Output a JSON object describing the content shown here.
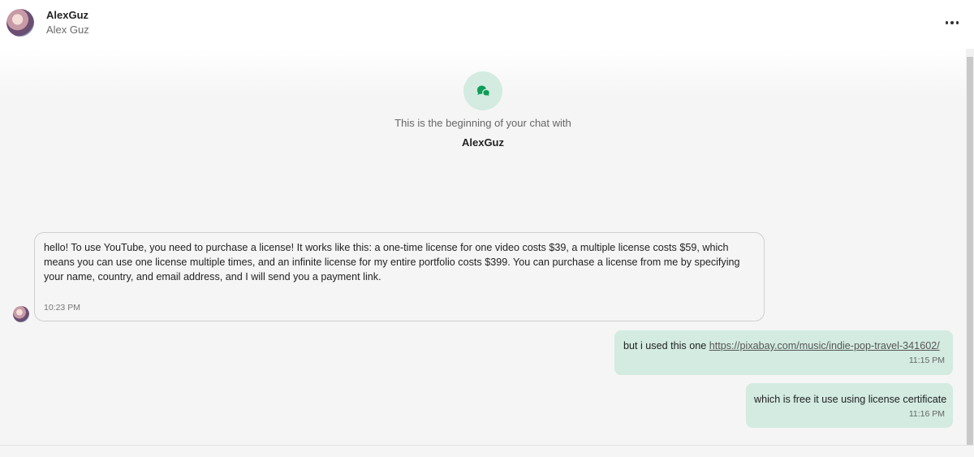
{
  "header": {
    "display_name": "AlexGuz",
    "username": "Alex Guz",
    "more_icon": "more-horizontal-icon"
  },
  "chat_start": {
    "icon": "chat-bubbles-icon",
    "text": "This is the beginning of your chat with",
    "name": "AlexGuz"
  },
  "messages": [
    {
      "direction": "incoming",
      "text": "hello! To use YouTube, you need to purchase a license! It works like this: a one-time license for one video costs $39, a multiple license costs $59, which means you can use one license multiple times, and an infinite license for my entire portfolio costs $399. You can purchase a license from me by specifying your name, country, and email address, and I will send you a payment link.",
      "time": "10:23 PM"
    },
    {
      "direction": "outgoing",
      "text": "but i used this one",
      "link": "https://pixabay.com/music/indie-pop-travel-341602/",
      "time": "11:15 PM"
    },
    {
      "direction": "outgoing",
      "text": "which is free it use using license certificate",
      "time": "11:16 PM"
    }
  ],
  "colors": {
    "accent": "#0f9d58",
    "accent_bg": "#d3ebe1",
    "outgoing_bubble": "#d3ebe1",
    "incoming_bubble": "#f5f5f5"
  }
}
